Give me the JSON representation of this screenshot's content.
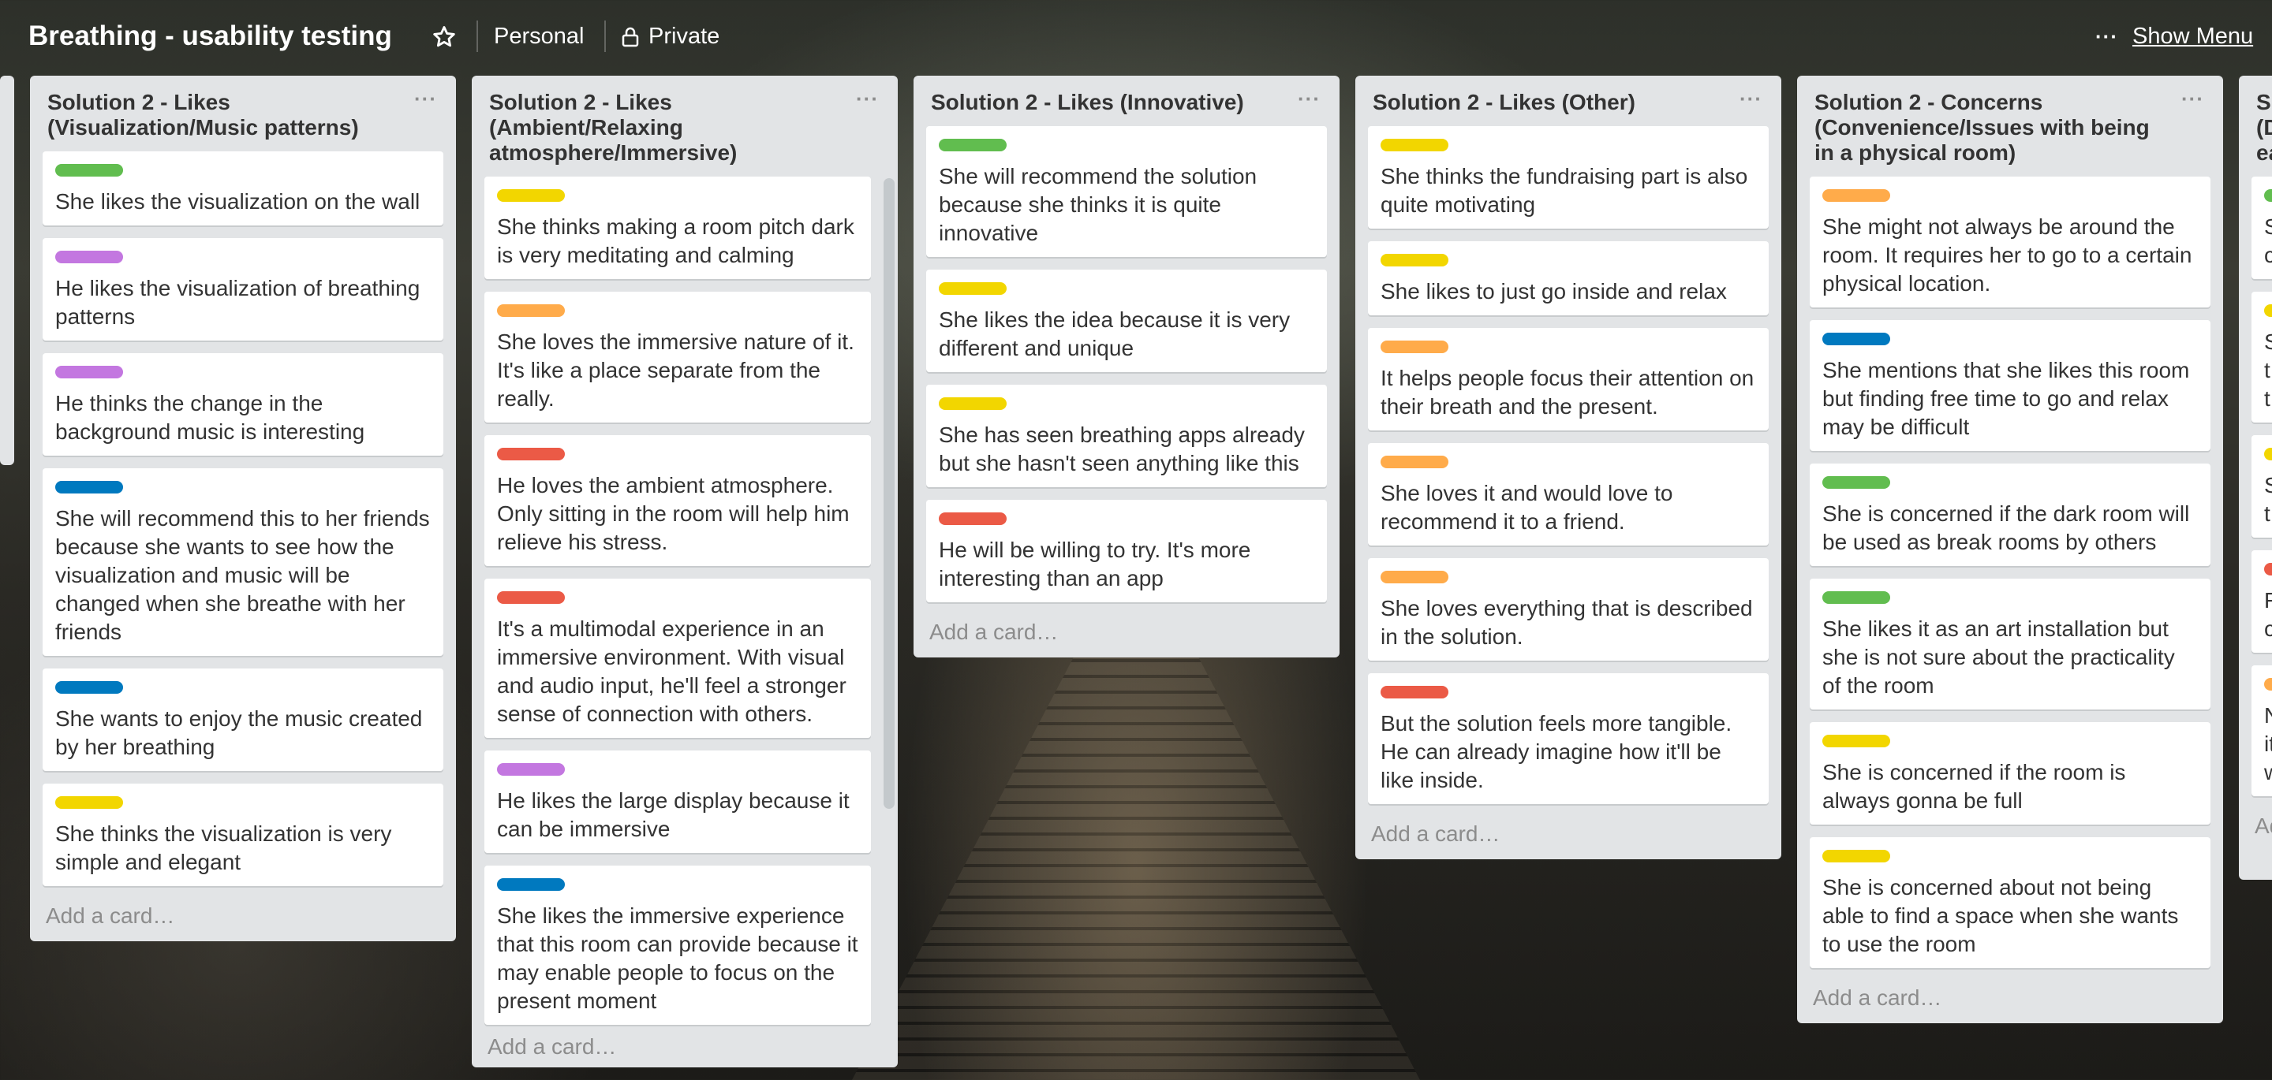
{
  "header": {
    "board_title": "Breathing - usability testing",
    "personal": "Personal",
    "private": "Private",
    "show_menu": "Show Menu",
    "menu_dots": "···"
  },
  "label_colors": {
    "green": "#61bd4f",
    "yellow": "#f2d600",
    "orange": "#ffab4a",
    "red": "#eb5a46",
    "purple": "#c377e0",
    "blue": "#0079bf"
  },
  "lists": [
    {
      "title": "Solution 2 - Likes (Visualization/Music patterns)",
      "menu": "···",
      "add_card": "Add a card…",
      "cards": [
        {
          "label": "green",
          "text": "She likes the visualization on the wall"
        },
        {
          "label": "purple",
          "text": "He likes the visualization of breathing patterns"
        },
        {
          "label": "purple",
          "text": "He thinks the change in the background music is interesting"
        },
        {
          "label": "blue",
          "text": "She will recommend this to her friends because she wants to see how the visualization and music will be changed when she breathe with her friends"
        },
        {
          "label": "blue",
          "text": "She wants to enjoy the music created by her breathing"
        },
        {
          "label": "yellow",
          "text": "She thinks the visualization is very simple and elegant"
        }
      ]
    },
    {
      "title": "Solution 2 - Likes (Ambient/Relaxing atmosphere/Immersive)",
      "menu": "···",
      "add_card": "Add a card…",
      "cards": [
        {
          "label": "yellow",
          "text": "She thinks making a room pitch dark is very meditating and calming"
        },
        {
          "label": "orange",
          "text": "She loves the immersive nature of it. It's like a place separate from the really."
        },
        {
          "label": "red",
          "text": "He loves the ambient atmosphere. Only sitting in the room will help him relieve his stress."
        },
        {
          "label": "red",
          "text": "It's a multimodal experience in an immersive environment. With visual and audio input, he'll feel a stronger sense of connection with others."
        },
        {
          "label": "purple",
          "text": "He likes the large display because it can be immersive"
        },
        {
          "label": "blue",
          "text": "She likes the immersive experience that this room can provide because it may enable people to focus on the present moment"
        }
      ]
    },
    {
      "title": "Solution 2 - Likes (Innovative)",
      "menu": "···",
      "add_card": "Add a card…",
      "cards": [
        {
          "label": "green",
          "text": "She will recommend the solution because she thinks it is quite innovative"
        },
        {
          "label": "yellow",
          "text": "She likes the idea because it is very different and unique"
        },
        {
          "label": "yellow",
          "text": "She has seen breathing apps already but she hasn't seen anything like this"
        },
        {
          "label": "red",
          "text": "He will be willing to try. It's more interesting than an app"
        }
      ]
    },
    {
      "title": "Solution 2 - Likes (Other)",
      "menu": "···",
      "add_card": "Add a card…",
      "cards": [
        {
          "label": "yellow",
          "text": "She thinks the fundraising part is also quite motivating"
        },
        {
          "label": "yellow",
          "text": "She likes to just go inside and relax"
        },
        {
          "label": "orange",
          "text": "It helps people focus their attention on their breath and the present."
        },
        {
          "label": "orange",
          "text": "She loves it and would love to recommend it to a friend."
        },
        {
          "label": "orange",
          "text": "She loves everything that is described in the solution."
        },
        {
          "label": "red",
          "text": "But the solution feels more tangible. He can already imagine how it'll be like inside."
        }
      ]
    },
    {
      "title": "Solution 2 - Concerns (Convenience/Issues with being in a physical room)",
      "menu": "···",
      "add_card": "Add a card…",
      "cards": [
        {
          "label": "orange",
          "text": "She might not always be around the room. It requires her to go to a certain physical location."
        },
        {
          "label": "blue",
          "text": "She mentions that she likes this room but finding free time to go and relax may be difficult"
        },
        {
          "label": "green",
          "text": "She is concerned if the dark room will be used as break rooms by others"
        },
        {
          "label": "green",
          "text": "She likes it as an art installation but she is not sure about the practicality of the room"
        },
        {
          "label": "yellow",
          "text": "She is concerned if the room is always gonna be full"
        },
        {
          "label": "yellow",
          "text": "She is concerned about not being able to find a space when she wants to use the room"
        }
      ]
    }
  ],
  "partial_list": {
    "title_fragments": [
      "S",
      "(D",
      "ea"
    ],
    "card_fragments": [
      {
        "label": "green",
        "lines": [
          "S",
          "c"
        ]
      },
      {
        "label": "yellow",
        "lines": [
          "S",
          "t",
          "t"
        ]
      },
      {
        "label": "yellow",
        "lines": [
          "S",
          "t"
        ]
      },
      {
        "label": "red",
        "lines": [
          "F",
          "c"
        ]
      },
      {
        "label": "orange",
        "lines": [
          "N",
          "it",
          "w"
        ]
      }
    ],
    "add_fragment": "Ad"
  }
}
